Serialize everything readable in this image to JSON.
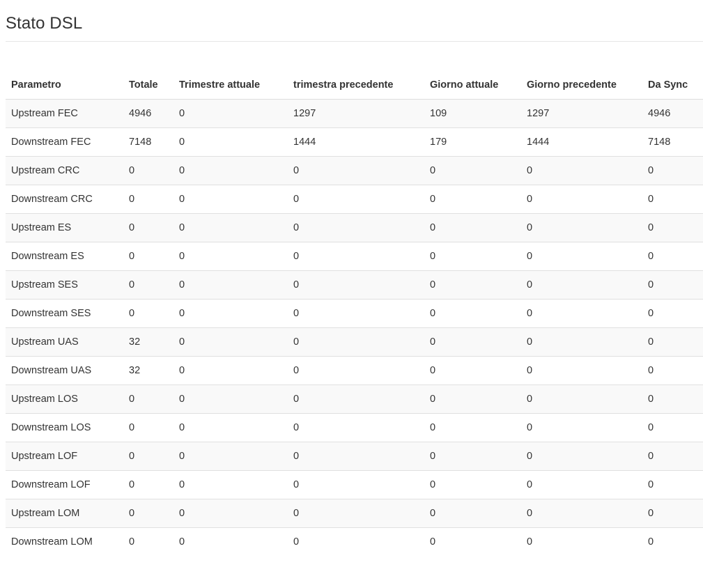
{
  "page": {
    "title": "Stato DSL"
  },
  "table": {
    "headers": [
      "Parametro",
      "Totale",
      "Trimestre attuale",
      "trimestra precedente",
      "Giorno attuale",
      "Giorno precedente",
      "Da Sync"
    ],
    "rows": [
      [
        "Upstream FEC",
        "4946",
        "0",
        "1297",
        "109",
        "1297",
        "4946"
      ],
      [
        "Downstream FEC",
        "7148",
        "0",
        "1444",
        "179",
        "1444",
        "7148"
      ],
      [
        "Upstream CRC",
        "0",
        "0",
        "0",
        "0",
        "0",
        "0"
      ],
      [
        "Downstream CRC",
        "0",
        "0",
        "0",
        "0",
        "0",
        "0"
      ],
      [
        "Upstream ES",
        "0",
        "0",
        "0",
        "0",
        "0",
        "0"
      ],
      [
        "Downstream ES",
        "0",
        "0",
        "0",
        "0",
        "0",
        "0"
      ],
      [
        "Upstream SES",
        "0",
        "0",
        "0",
        "0",
        "0",
        "0"
      ],
      [
        "Downstream SES",
        "0",
        "0",
        "0",
        "0",
        "0",
        "0"
      ],
      [
        "Upstream UAS",
        "32",
        "0",
        "0",
        "0",
        "0",
        "0"
      ],
      [
        "Downstream UAS",
        "32",
        "0",
        "0",
        "0",
        "0",
        "0"
      ],
      [
        "Upstream LOS",
        "0",
        "0",
        "0",
        "0",
        "0",
        "0"
      ],
      [
        "Downstream LOS",
        "0",
        "0",
        "0",
        "0",
        "0",
        "0"
      ],
      [
        "Upstream LOF",
        "0",
        "0",
        "0",
        "0",
        "0",
        "0"
      ],
      [
        "Downstream LOF",
        "0",
        "0",
        "0",
        "0",
        "0",
        "0"
      ],
      [
        "Upstream LOM",
        "0",
        "0",
        "0",
        "0",
        "0",
        "0"
      ],
      [
        "Downstream LOM",
        "0",
        "0",
        "0",
        "0",
        "0",
        "0"
      ]
    ]
  }
}
